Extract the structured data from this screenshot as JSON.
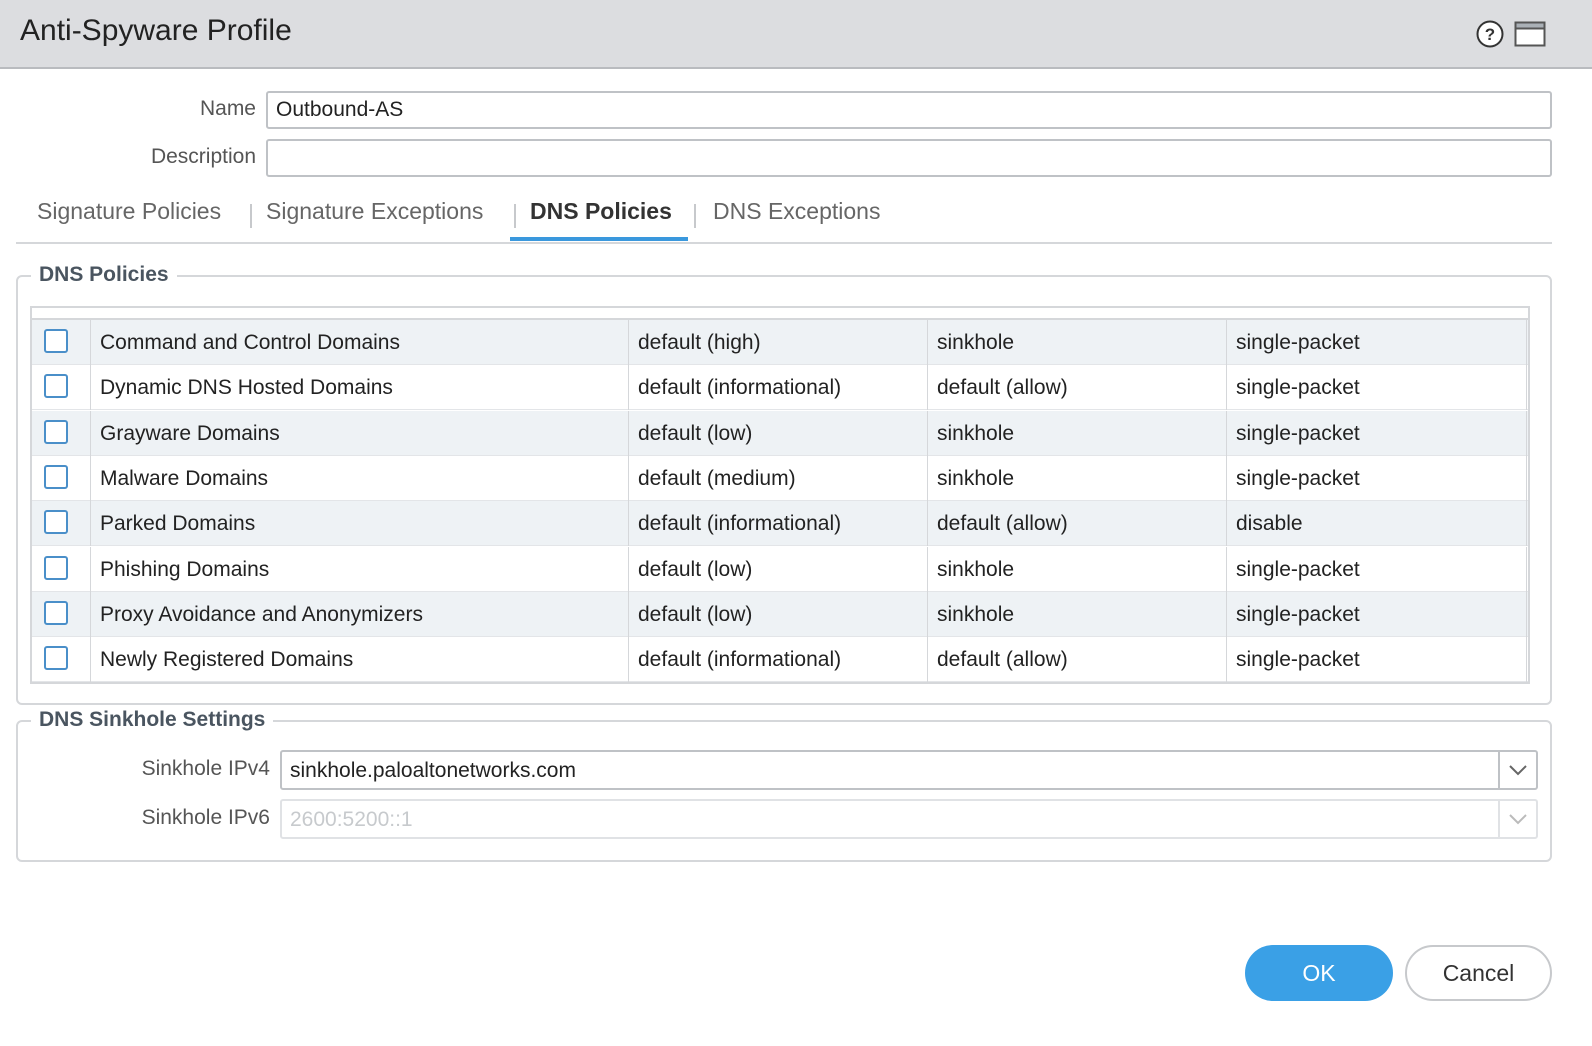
{
  "dialog": {
    "title": "Anti-Spyware Profile",
    "help_icon": "question-circle-icon",
    "maximize_icon": "window-maximize-icon"
  },
  "form": {
    "name_label": "Name",
    "name_value": "Outbound-AS",
    "description_label": "Description",
    "description_value": ""
  },
  "tabs": [
    {
      "label": "Signature Policies",
      "active": false
    },
    {
      "label": "Signature Exceptions",
      "active": false
    },
    {
      "label": "DNS Policies",
      "active": true
    },
    {
      "label": "DNS Exceptions",
      "active": false
    }
  ],
  "dns_policies": {
    "legend": "DNS Policies",
    "rows": [
      {
        "name": "Command and Control Domains",
        "log_severity": "default (high)",
        "action": "sinkhole",
        "packet_capture": "single-packet"
      },
      {
        "name": "Dynamic DNS Hosted Domains",
        "log_severity": "default (informational)",
        "action": "default (allow)",
        "packet_capture": "single-packet"
      },
      {
        "name": "Grayware Domains",
        "log_severity": "default (low)",
        "action": "sinkhole",
        "packet_capture": "single-packet"
      },
      {
        "name": "Malware Domains",
        "log_severity": "default (medium)",
        "action": "sinkhole",
        "packet_capture": "single-packet"
      },
      {
        "name": "Parked Domains",
        "log_severity": "default (informational)",
        "action": "default (allow)",
        "packet_capture": "disable"
      },
      {
        "name": "Phishing Domains",
        "log_severity": "default (low)",
        "action": "sinkhole",
        "packet_capture": "single-packet"
      },
      {
        "name": "Proxy Avoidance and Anonymizers",
        "log_severity": "default (low)",
        "action": "sinkhole",
        "packet_capture": "single-packet"
      },
      {
        "name": "Newly Registered Domains",
        "log_severity": "default (informational)",
        "action": "default (allow)",
        "packet_capture": "single-packet"
      }
    ]
  },
  "sinkhole": {
    "legend": "DNS Sinkhole Settings",
    "ipv4_label": "Sinkhole IPv4",
    "ipv4_value": "sinkhole.paloaltonetworks.com",
    "ipv6_label": "Sinkhole IPv6",
    "ipv6_value": "2600:5200::1"
  },
  "buttons": {
    "ok_label": "OK",
    "cancel_label": "Cancel"
  },
  "colors": {
    "accent": "#3aa0e6",
    "tab_underline": "#3a98dd",
    "checkbox_border": "#4a8fc9",
    "row_alt": "#eef2f5",
    "header_bg": "#dcdde0"
  }
}
